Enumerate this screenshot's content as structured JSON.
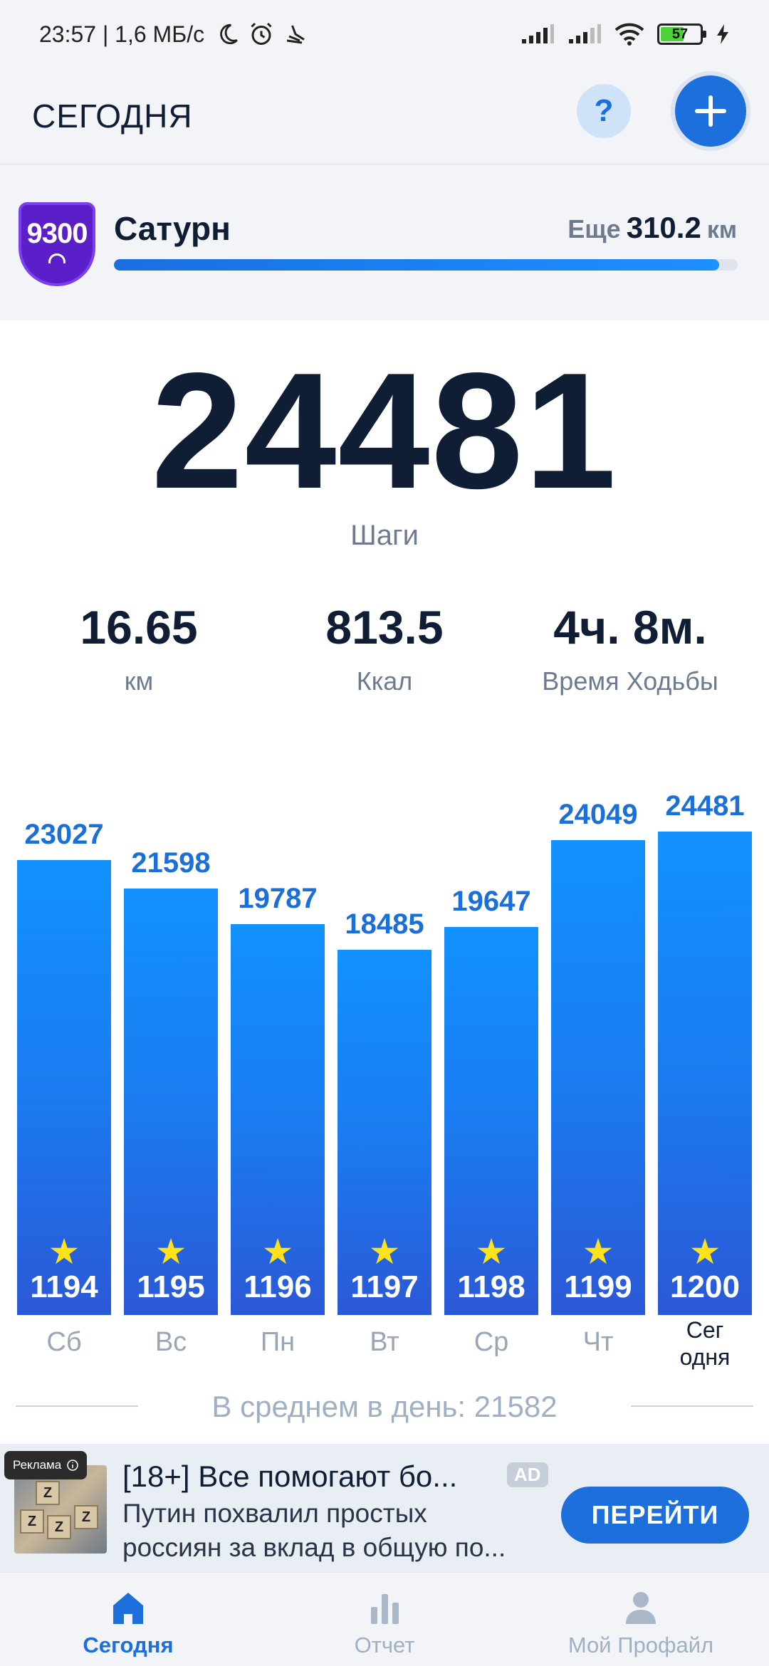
{
  "status_bar": {
    "time": "23:57",
    "network_speed": "1,6 МБ/с",
    "battery": "57"
  },
  "header": {
    "title": "СЕГОДНЯ",
    "help_label": "?"
  },
  "goal": {
    "badge_number": "9300",
    "name": "Сатурн",
    "remaining_label": "Еще",
    "remaining_value": "310.2",
    "remaining_unit": "км",
    "progress_fraction": 0.97
  },
  "today": {
    "steps": "24481",
    "steps_label": "Шаги",
    "distance_value": "16.65",
    "distance_label": "км",
    "calories_value": "813.5",
    "calories_label": "Ккал",
    "time_value": "4ч. 8м.",
    "time_label": "Время Ходьбы"
  },
  "chart_data": {
    "type": "bar",
    "categories": [
      "Сб",
      "Вс",
      "Пн",
      "Вт",
      "Ср",
      "Чт",
      "Сег\nодня"
    ],
    "values": [
      23027,
      21598,
      19787,
      18485,
      19647,
      24049,
      24481
    ],
    "day_numbers": [
      "1194",
      "1195",
      "1196",
      "1197",
      "1198",
      "1199",
      "1200"
    ],
    "today_index": 6
  },
  "average": {
    "label": "В среднем в день: 21582"
  },
  "ad": {
    "tag": "Реклама",
    "headline": "[18+] Все помогают бо...",
    "badge": "AD",
    "description_line1": "Путин похвалил простых",
    "description_line2": "россиян за вклад в общую по...",
    "cta": "ПЕРЕЙТИ"
  },
  "nav": {
    "items": [
      {
        "label": "Сегодня",
        "icon": "home-icon",
        "active": true
      },
      {
        "label": "Отчет",
        "icon": "bar-chart-icon",
        "active": false
      },
      {
        "label": "Мой Профайл",
        "icon": "person-icon",
        "active": false
      }
    ]
  },
  "colors": {
    "accent": "#1d6fdb",
    "bar_top": "#1291ff",
    "bar_bottom": "#2b58d6",
    "star": "#ffe21a",
    "badge": "#5a1fc8"
  }
}
